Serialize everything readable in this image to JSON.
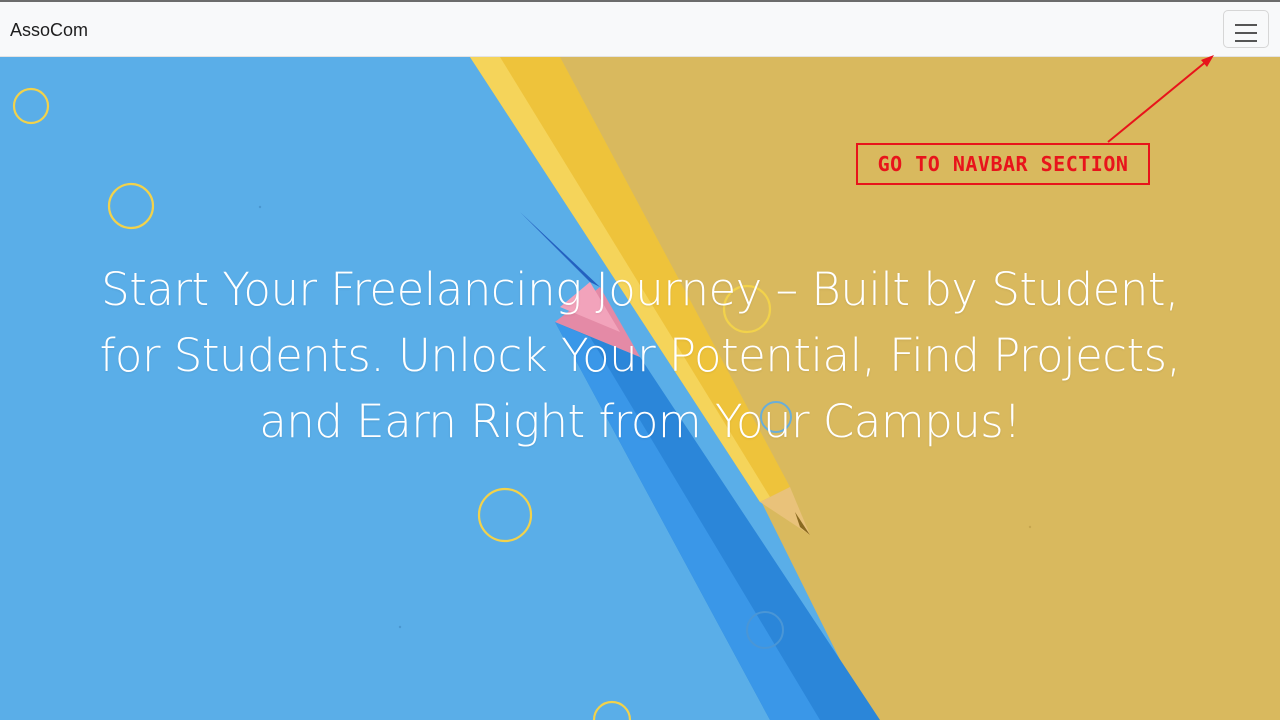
{
  "navbar": {
    "brand": "AssoCom",
    "toggler_icon": "hamburger-menu-icon"
  },
  "hero": {
    "headline": "Start Your Freelancing Journey – Built by Student, for Students. Unlock Your Potential, Find Projects, and Earn Right from Your Campus!"
  },
  "annotation": {
    "label": "GO TO NAVBAR SECTION",
    "color": "#e8141b"
  },
  "colors": {
    "sky_blue": "#5aaee8",
    "paper_yellow": "#d9b95e",
    "circle_yellow": "#f2d24b"
  }
}
